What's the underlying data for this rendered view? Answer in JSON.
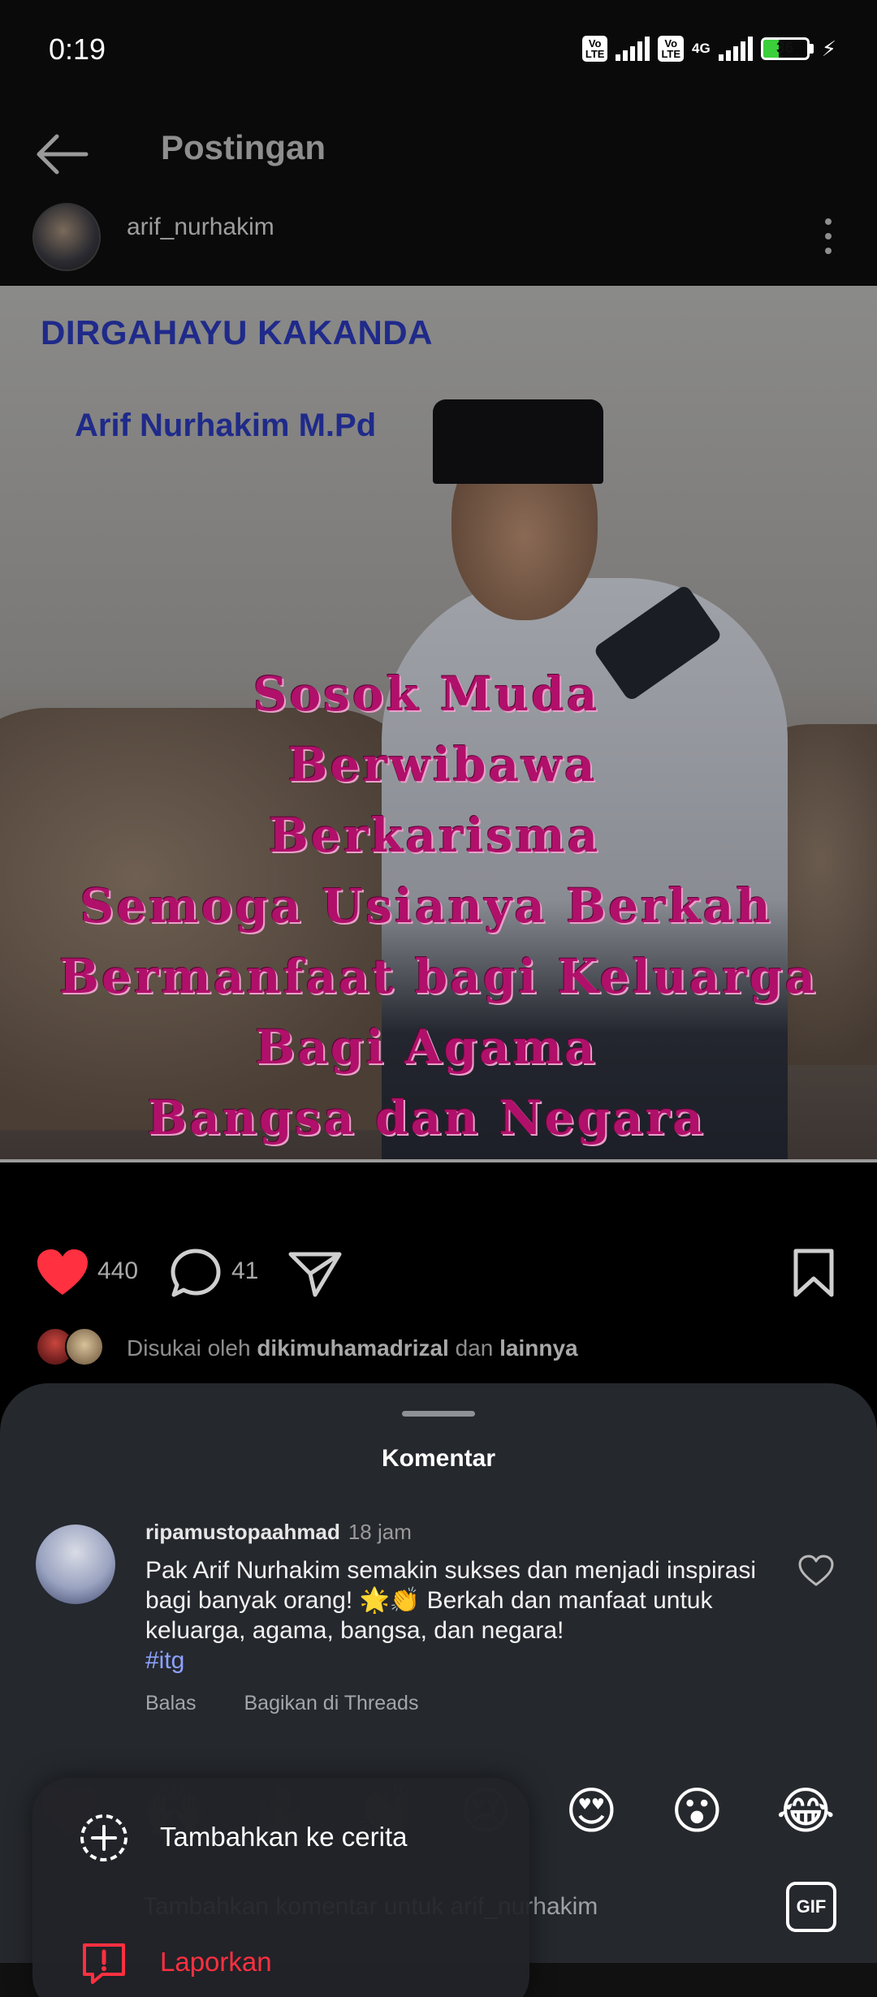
{
  "status_bar": {
    "time": "0:19",
    "volte_label": "Vo LTE",
    "network": "4G",
    "battery": 36
  },
  "header": {
    "title": "Postingan"
  },
  "post": {
    "username": "arif_nurhakim",
    "image_text": {
      "title": "DIRGAHAYU KAKANDA",
      "name": "Arif Nurhakim M.Pd",
      "lines": [
        "Sosok Muda",
        "Berwibawa",
        "Berkarisma",
        "Semoga Usianya Berkah",
        "Bermanfaat bagi Keluarga",
        "Bagi Agama",
        "Bangsa dan Negara"
      ]
    },
    "likes": "440",
    "comments": "41",
    "liked_by_prefix": "Disukai oleh",
    "liked_by_user": "dikimuhamadrizal",
    "liked_by_join": "dan",
    "liked_by_others": "lainnya"
  },
  "comments_sheet": {
    "title": "Komentar",
    "comment": {
      "username": "ripamustopaahmad",
      "time": "18 jam",
      "text": "Pak Arif Nurhakim semakin sukses dan menjadi inspirasi bagi banyak orang! 🌟👏 Berkah dan manfaat untuk keluarga, agama, bangsa, dan negara!",
      "hashtag": "#itg",
      "reply_label": "Balas",
      "share_label": "Bagikan di Threads"
    },
    "emojis": [
      "❤️",
      "🙌",
      "🔥",
      "👏",
      "😢",
      "😍",
      "😮",
      "😂"
    ],
    "input_placeholder": "Tambahkan komentar untuk arif_nurhakim",
    "gif_label": "GIF"
  },
  "popup_menu": {
    "items": [
      {
        "label": "Tambahkan ke cerita",
        "icon": "add-circle-icon"
      },
      {
        "label": "Laporkan",
        "icon": "report-icon"
      }
    ]
  },
  "colors": {
    "like_red": "#ff3040",
    "report_red": "#ff3040",
    "hashtag": "#8da2ff",
    "sheet_bg": "#25282d"
  }
}
